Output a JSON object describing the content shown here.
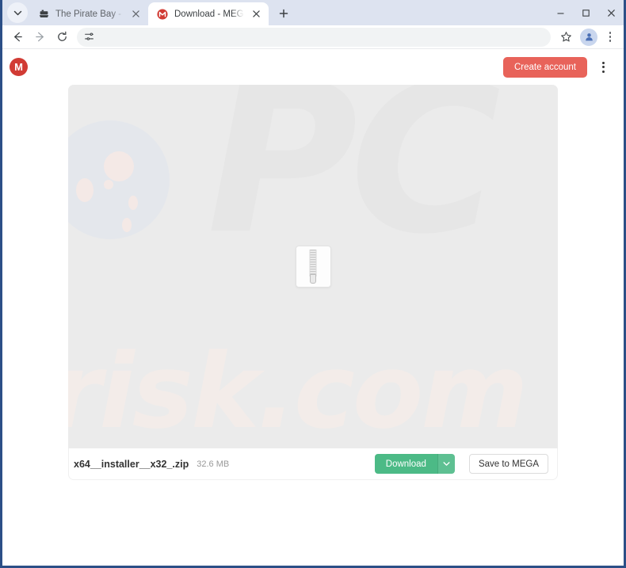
{
  "browser": {
    "tabs": [
      {
        "title": "The Pirate Bay - The galaxy's m",
        "favicon": "ship-icon",
        "active": false,
        "close_label": "close-tab"
      },
      {
        "title": "Download - MEGA",
        "favicon": "mega-favicon",
        "active": true,
        "close_label": "close-tab"
      }
    ],
    "new_tab_label": "+",
    "tab_list_icon": "chevron-down-icon",
    "window_controls": {
      "minimize": "minimize-icon",
      "maximize": "maximize-icon",
      "close": "close-icon"
    },
    "toolbar": {
      "back_icon": "back-arrow-icon",
      "forward_icon": "forward-arrow-icon",
      "reload_icon": "reload-icon",
      "omnibox_icon": "tune-sliders-icon",
      "omnibox_value": "",
      "omnibox_placeholder": "",
      "bookmark_icon": "star-icon",
      "profile_icon": "profile-avatar-icon",
      "menu_icon": "three-dot-menu-icon"
    }
  },
  "site": {
    "header": {
      "logo_letter": "M",
      "logo_name": "mega-logo",
      "create_account_label": "Create account",
      "menu_icon": "three-dot-menu-icon"
    },
    "preview": {
      "file_icon": "zip-file-icon",
      "watermark_top": "PC",
      "watermark_bottom": "risk.com"
    },
    "file": {
      "name": "x64__installer__x32_.zip",
      "size": "32.6 MB",
      "download_label": "Download",
      "download_dropdown_icon": "chevron-down-icon",
      "save_to_mega_label": "Save to MEGA"
    }
  },
  "colors": {
    "mega_red": "#d13b34",
    "create_account_bg": "#e8635a",
    "download_green": "#4cba86",
    "window_border": "#2c4f87",
    "tabstrip_bg": "#dde3f0",
    "preview_bg": "#ebebeb"
  }
}
